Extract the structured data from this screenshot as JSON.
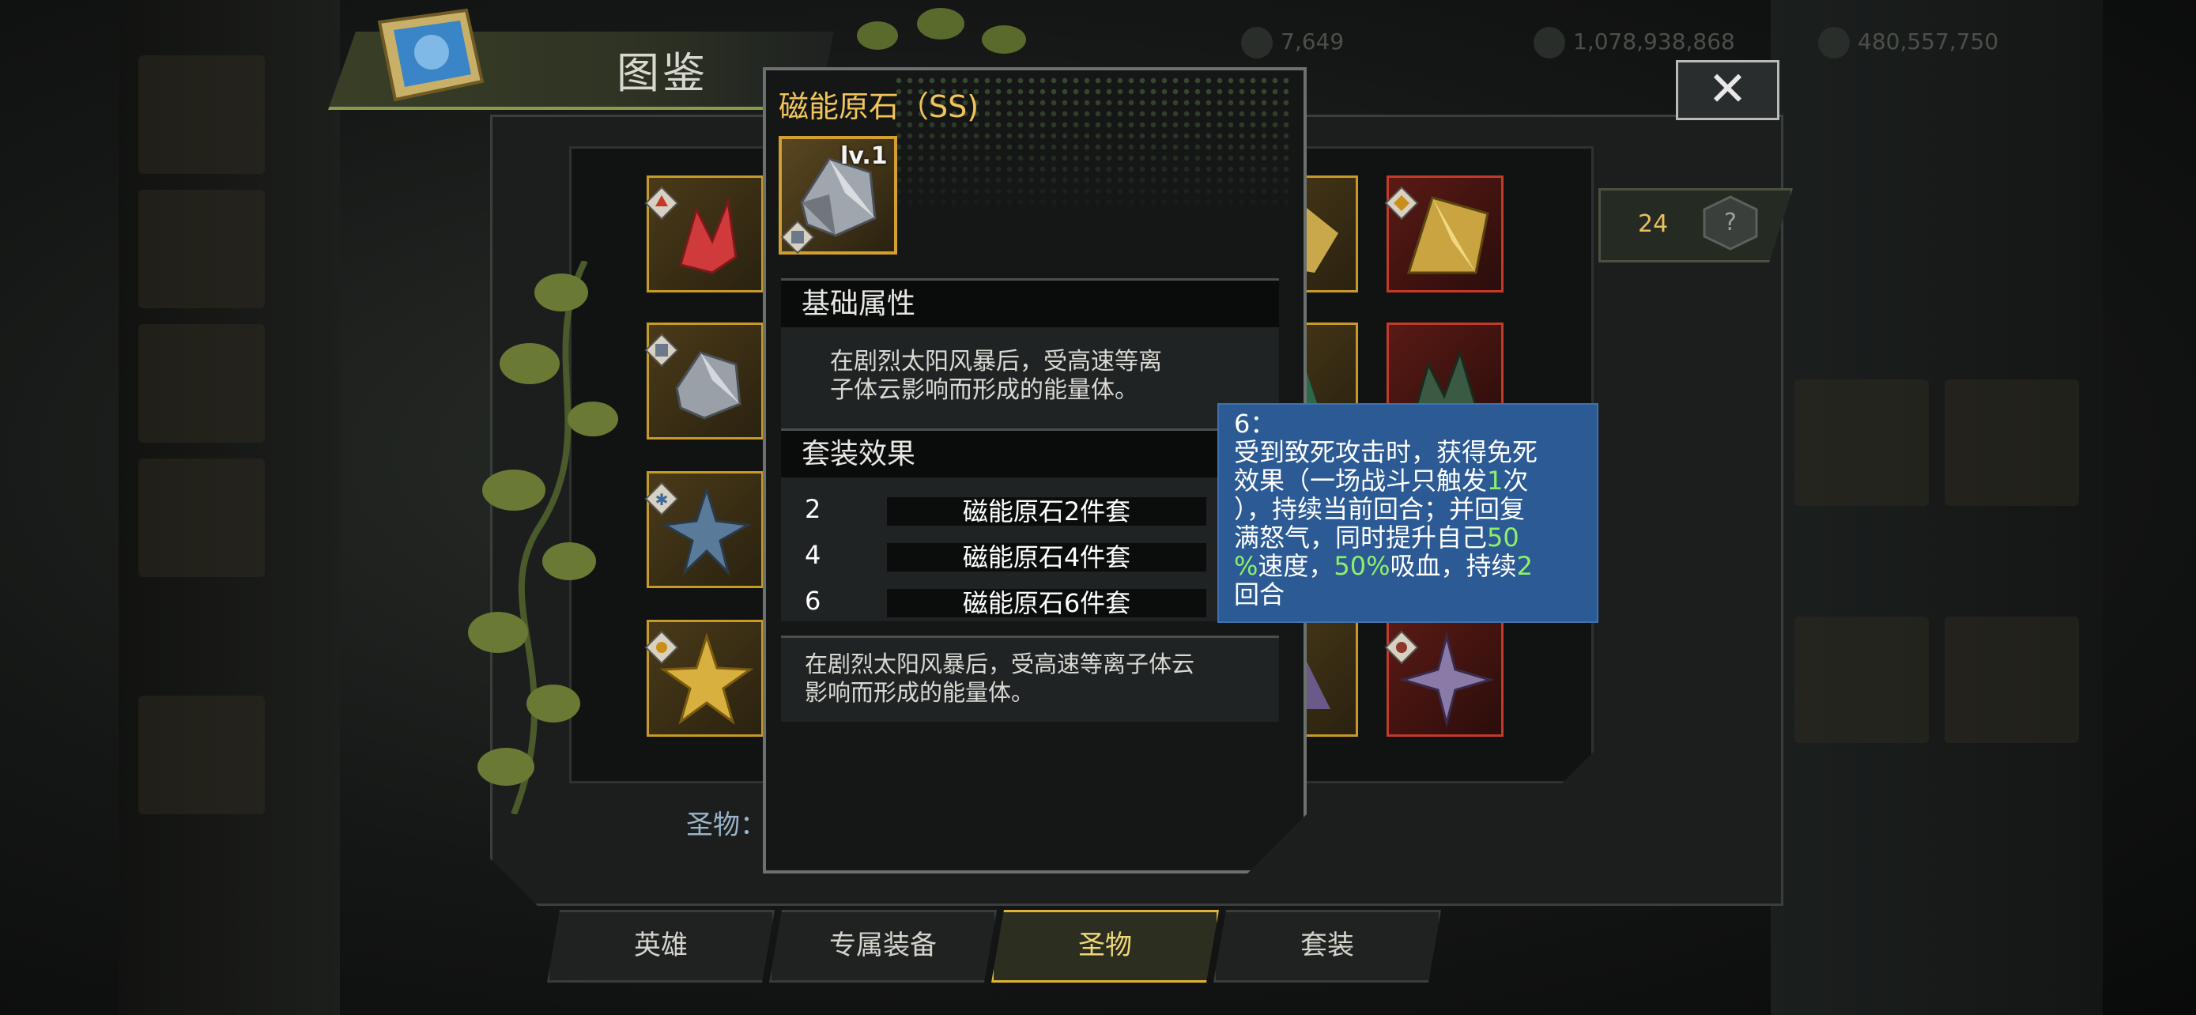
{
  "header": {
    "title": "图鉴",
    "close_symbol": "✕"
  },
  "resources": [
    {
      "icon": "energy-icon",
      "value": "7,649"
    },
    {
      "icon": "coin-icon",
      "value": "1,078,938,868"
    },
    {
      "icon": "gem-icon",
      "value": "480,557,750"
    }
  ],
  "counter": {
    "value": "24",
    "icon": "mystery-box-icon"
  },
  "grid": {
    "slots": [
      {
        "col": 0,
        "row": 0,
        "frame": "gold",
        "item_icon": "red-crystal-icon",
        "badge_icon": "wing-badge-icon"
      },
      {
        "col": 0,
        "row": 1,
        "frame": "gold",
        "item_icon": "magnetic-ore-icon",
        "badge_icon": "shield-badge-icon"
      },
      {
        "col": 0,
        "row": 2,
        "frame": "gold",
        "item_icon": "blue-shard-icon",
        "badge_icon": "snowflake-badge-icon"
      },
      {
        "col": 0,
        "row": 3,
        "frame": "gold",
        "item_icon": "gold-star-icon",
        "badge_icon": "sun-badge-icon"
      },
      {
        "col": 1,
        "row": 0,
        "frame": "gold",
        "item_icon": "gold-ore-icon",
        "badge_icon": ""
      },
      {
        "col": 1,
        "row": 1,
        "frame": "gold",
        "item_icon": "green-crystal-icon",
        "badge_icon": ""
      },
      {
        "col": 1,
        "row": 3,
        "frame": "gold",
        "item_icon": "purple-shard-icon",
        "badge_icon": ""
      },
      {
        "col": 2,
        "row": 0,
        "frame": "red",
        "item_icon": "gold-pyramid-icon",
        "badge_icon": "diamond-badge-icon"
      },
      {
        "col": 2,
        "row": 1,
        "frame": "red",
        "item_icon": "dark-green-crystal-icon",
        "badge_icon": ""
      },
      {
        "col": 2,
        "row": 3,
        "frame": "red",
        "item_icon": "purple-star-icon",
        "badge_icon": "sun-badge-icon"
      }
    ]
  },
  "footer_label": "圣物：",
  "tabs": [
    {
      "label": "英雄",
      "active": false
    },
    {
      "label": "专属装备",
      "active": false
    },
    {
      "label": "圣物",
      "active": true
    },
    {
      "label": "套装",
      "active": false
    }
  ],
  "detail": {
    "title": "磁能原石（SS)",
    "level": "lv.1",
    "base_section": {
      "heading": "基础属性",
      "desc_line1": "在剧烈太阳风暴后，受高速等离",
      "desc_line2": "子体云影响而形成的能量体。"
    },
    "set_section": {
      "heading": "套装效果",
      "rows": [
        {
          "count": "2",
          "name": "磁能原石2件套"
        },
        {
          "count": "4",
          "name": "磁能原石4件套"
        },
        {
          "count": "6",
          "name": "磁能原石6件套"
        }
      ]
    },
    "lore_line1": "在剧烈太阳风暴后，受高速等离子体云",
    "lore_line2": "影响而形成的能量体。"
  },
  "tooltip": {
    "line1": "6：",
    "line2": "受到致死攻击时，获得免死",
    "line3a": "效果（一场战斗只触发",
    "line3b": "1",
    "line3c": "次",
    "line4": "），持续当前回合；并回复",
    "line5a": "满怒气，同时提升自己",
    "line5b": "50",
    "line6a": "%",
    "line6b": "速度，",
    "line6c": "50%",
    "line6d": "吸血，持续",
    "line6e": "2",
    "line7": "回合"
  },
  "colors": {
    "gold_frame": "#c79a28",
    "red_frame": "#c23a2a",
    "title_gold": "#f2c55a",
    "tooltip_bg": "#2b5a95",
    "highlight_green": "#8ef06a",
    "active_tab_border": "#e1b534"
  }
}
